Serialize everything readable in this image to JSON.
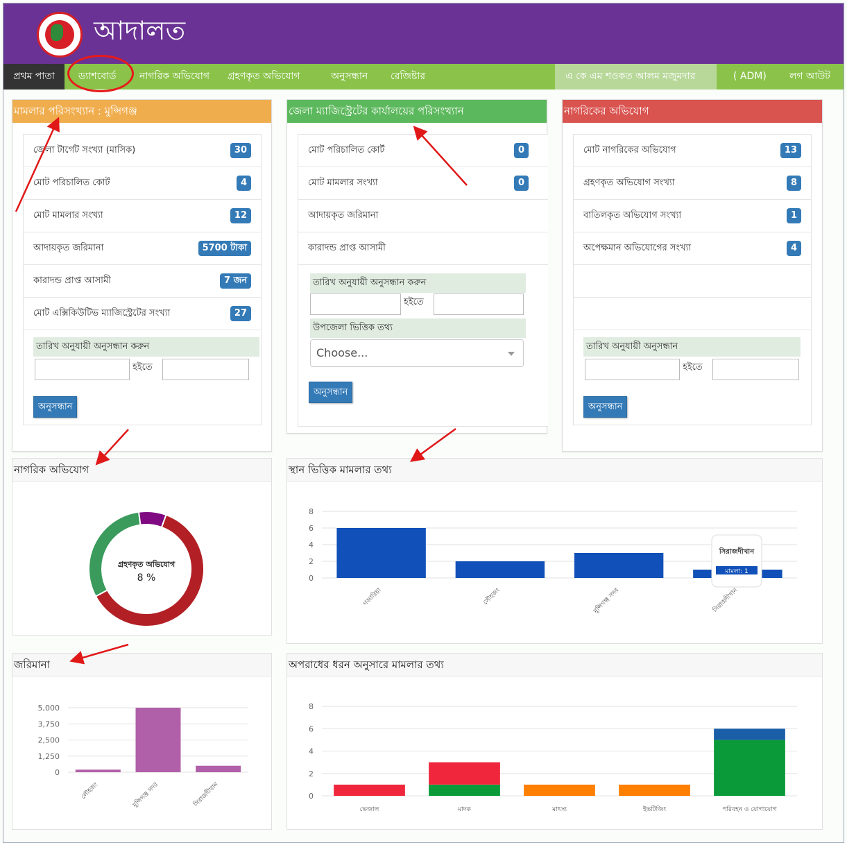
{
  "app": {
    "title": "আদালত"
  },
  "nav": {
    "home": "প্রথম পাতা",
    "items": [
      "ড্যাশবোর্ড",
      "নাগরিক অভিযোগ",
      "গ্রহণকৃত অভিযোগ",
      "অনুসন্ধান",
      "রেজিষ্টার"
    ],
    "user": "এ কে এম শওকত আলম মজুমদার",
    "role": "( ADM)",
    "logout": "লগ আউট"
  },
  "colors": {
    "header": "#6a3294",
    "nav": "#8bc34a",
    "orange": "#f0ad4e",
    "green": "#5cb85c",
    "red": "#d9534f",
    "badge": "#337ab7"
  },
  "panel1": {
    "title": "মামলার পরিসংখ্যান : মুন্সিগঞ্জ",
    "rows": [
      {
        "label": "জেলা টার্গেট সংখ্যা (মাসিক)",
        "badge": "30"
      },
      {
        "label": "মোট পরিচালিত কোর্ট",
        "badge": "4"
      },
      {
        "label": "মোট মামলার সংখ্যা",
        "badge": "12"
      },
      {
        "label": "আদায়কৃত জরিমানা",
        "badge": "5700 টাকা"
      },
      {
        "label": "কারাদন্ড প্রাপ্ত আসামী",
        "badge": "7 জন"
      },
      {
        "label": "মোট এক্সিকিউটিভ ম্যাজিস্ট্রেটের সংখ্যা",
        "badge": "27"
      }
    ],
    "search_label": "তারিখ অনুযায়ী অনুসন্ধান করুন",
    "hoite": "হইতে",
    "button": "অনুসন্ধান"
  },
  "panel2": {
    "title": "জেলা ম্যাজিস্ট্রেটের কার্যালয়ের পরিসংখ্যান",
    "rows": [
      {
        "label": "মোট পরিচালিত কোর্ট",
        "badge": "0"
      },
      {
        "label": "মোট মামলার সংখ্যা",
        "badge": "0"
      },
      {
        "label": "আদায়কৃত জরিমানা"
      },
      {
        "label": "কারাদন্ড প্রাপ্ত আসামী"
      }
    ],
    "search_label": "তারিখ অনুযায়ী অনুসন্ধান করুন",
    "hoite": "হইতে",
    "upazila_label": "উপজেলা ভিত্তিক তথ্য",
    "select_value": "Choose...",
    "button": "অনুসন্ধান"
  },
  "panel3": {
    "title": "নাগরিকের অভিযোগ",
    "rows": [
      {
        "label": "মোট নাগরিকের অভিযোগ",
        "badge": "13"
      },
      {
        "label": "গ্রহণকৃত অভিযোগ সংখ্যা",
        "badge": "8"
      },
      {
        "label": "বাতিলকৃত অভিযোগ সংখ্যা",
        "badge": "1"
      },
      {
        "label": "অপেক্ষমান অভিযোগের সংখ্যা",
        "badge": "4"
      }
    ],
    "search_label": "তারিখ অনুযায়ী অনুসন্ধান",
    "hoite": "হইতে",
    "button": "অনুসন্ধান"
  },
  "chart_titles": {
    "complaints": "নাগরিক অভিযোগ",
    "location": "স্থান ভিত্তিক মামলার তথ্য",
    "fines": "জরিমানা",
    "crime": "অপরাধের ধরন অনুসারে মামলার তথ্য"
  },
  "chart_data": [
    {
      "type": "pie",
      "center_label": "গ্রহণকৃত অভিযোগ",
      "center_value": "8 %",
      "slices": [
        {
          "value": 8,
          "color": "#b22026"
        },
        {
          "value": 4,
          "color": "#3a9b5c"
        },
        {
          "value": 1,
          "color": "#800a82"
        }
      ]
    },
    {
      "type": "bar",
      "categories": [
        "গজারিয়া",
        "লৌহজং",
        "মুন্সিগঞ্জ সদর",
        "সিরাজদীখান"
      ],
      "values": [
        6,
        2,
        3,
        1
      ],
      "ylim": [
        0,
        8
      ],
      "yticks": [
        0,
        2,
        4,
        6,
        8
      ],
      "color": "#1150b8",
      "tooltip": {
        "title": "সিরাজদীখান",
        "text": "মামলা: 1"
      }
    },
    {
      "type": "bar",
      "categories": [
        "লৌহজং",
        "মুন্সিগঞ্জ সদর",
        "সিরাজদীখান"
      ],
      "values": [
        200,
        5000,
        500
      ],
      "ylim": [
        0,
        5000
      ],
      "yticks": [
        "0",
        "1,250",
        "2,500",
        "3,750",
        "5,000"
      ],
      "color": "#b060a8"
    },
    {
      "type": "bar",
      "stacked": true,
      "categories": [
        "ভেজাল",
        "মাদক",
        "মাৎস্য",
        "ইভটিজিং",
        "পরিবহন ও যোগাযোগ"
      ],
      "ylim": [
        0,
        8
      ],
      "yticks": [
        0,
        2,
        4,
        6,
        8
      ],
      "series": [
        {
          "values": [
            0,
            1,
            0,
            0,
            5
          ],
          "color": "#0a9a3a"
        },
        {
          "values": [
            1,
            2,
            1,
            1,
            0
          ],
          "color": "#f0273c"
        },
        {
          "values": [
            0,
            0,
            0,
            0,
            0
          ],
          "color": "#ff7f00"
        },
        {
          "values": [
            0,
            0,
            0,
            0,
            1
          ],
          "color": "#1a5ea8"
        }
      ],
      "bar_colors_override": [
        "#f0273c",
        null,
        "#ff7f00",
        "#ff7f00",
        null
      ]
    }
  ]
}
